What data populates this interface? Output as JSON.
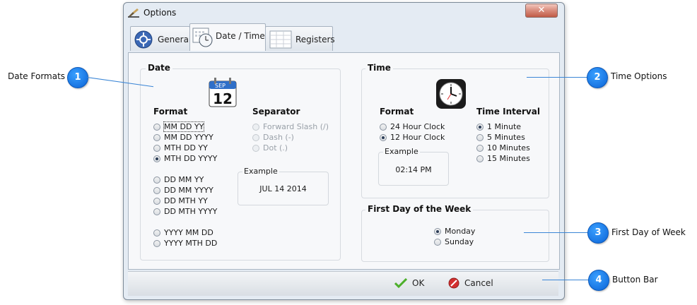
{
  "window": {
    "title": "Options",
    "close_glyph": "✕"
  },
  "tabs": [
    {
      "label": "General",
      "icon": "gear-icon"
    },
    {
      "label": "Date / Time",
      "icon": "calendar-clock-icon",
      "active": true
    },
    {
      "label": "Registers",
      "icon": "ledger-icon"
    }
  ],
  "date_group": {
    "legend": "Date",
    "calendar_icon": {
      "month": "SEP",
      "day": "12"
    },
    "format_header": "Format",
    "formats": [
      {
        "label": "MM DD YY",
        "checked": false
      },
      {
        "label": "MM DD YYYY",
        "checked": false
      },
      {
        "label": "MTH DD YY",
        "checked": false
      },
      {
        "label": "MTH DD YYYY",
        "checked": true
      },
      {
        "label": "DD MM YY",
        "checked": false
      },
      {
        "label": "DD MM YYYY",
        "checked": false
      },
      {
        "label": "DD MTH YY",
        "checked": false
      },
      {
        "label": "DD MTH YYYY",
        "checked": false
      },
      {
        "label": "YYYY MM DD",
        "checked": false
      },
      {
        "label": "YYYY MTH DD",
        "checked": false
      }
    ],
    "separator_header": "Separator",
    "separators": [
      {
        "label": "Forward Slash (/)",
        "disabled": true
      },
      {
        "label": "Dash (-)",
        "disabled": true
      },
      {
        "label": "Dot (.)",
        "disabled": true
      }
    ],
    "example_title": "Example",
    "example_value": "JUL 14 2014"
  },
  "time_group": {
    "legend": "Time",
    "format_header": "Format",
    "formats": [
      {
        "label": "24 Hour Clock",
        "checked": false
      },
      {
        "label": "12 Hour Clock",
        "checked": true
      }
    ],
    "example_title": "Example",
    "example_value": "02:14 PM",
    "interval_header": "Time Interval",
    "intervals": [
      {
        "label": "1 Minute",
        "checked": true
      },
      {
        "label": "5 Minutes",
        "checked": false
      },
      {
        "label": "10 Minutes",
        "checked": false
      },
      {
        "label": "15 Minutes",
        "checked": false
      }
    ]
  },
  "week_group": {
    "legend": "First Day of the Week",
    "days": [
      {
        "label": "Monday",
        "checked": true
      },
      {
        "label": "Sunday",
        "checked": false
      }
    ]
  },
  "buttons": {
    "ok": "OK",
    "cancel": "Cancel"
  },
  "callouts": [
    {
      "number": "1",
      "label": "Date Formats"
    },
    {
      "number": "2",
      "label": "Time Options"
    },
    {
      "number": "3",
      "label": "First Day of Week"
    },
    {
      "number": "4",
      "label": "Button Bar"
    }
  ],
  "colors": {
    "callout": "#0a63d6",
    "ok_check": "#4caf2a",
    "cancel": "#d32f2f"
  }
}
